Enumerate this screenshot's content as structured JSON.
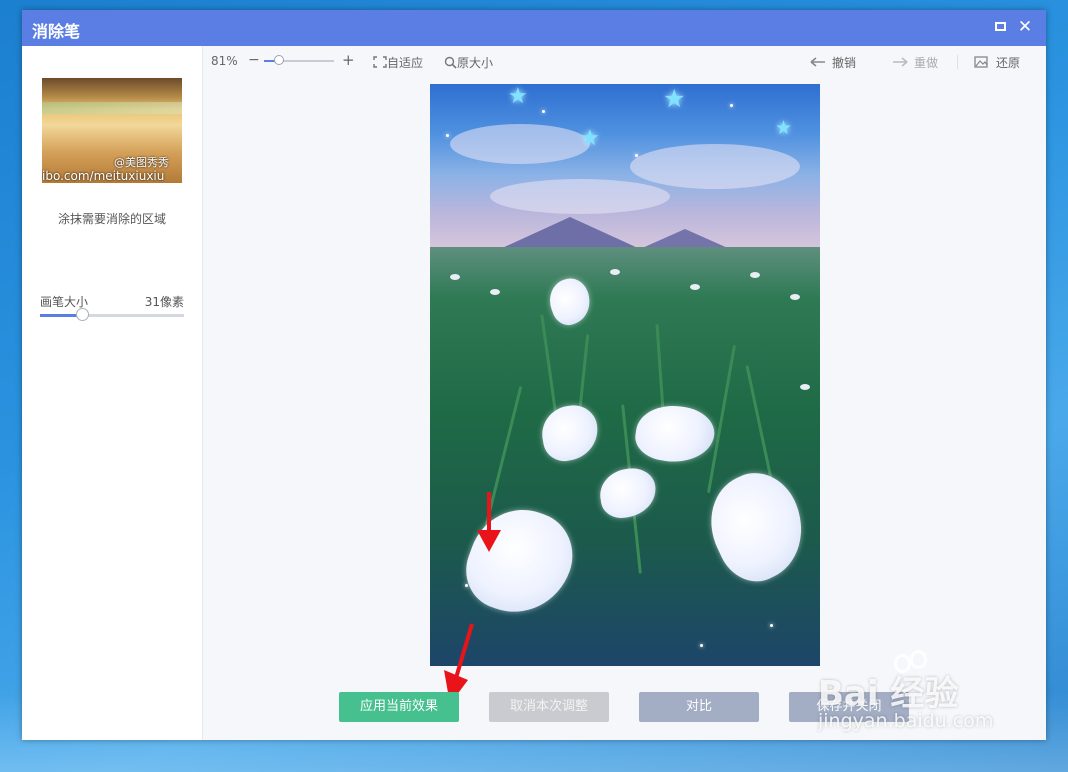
{
  "window": {
    "title": "消除笔"
  },
  "left_panel": {
    "thumbnail_watermark_1": "@美图秀秀",
    "thumbnail_watermark_2": "ibo.com/meituxiuxiu",
    "hint": "涂抹需要消除的区域",
    "brush": {
      "label": "画笔大小",
      "value": "31像素",
      "level": 0.29
    }
  },
  "toolbar": {
    "zoom_value": "81%",
    "zoom_minus": "−",
    "zoom_plus": "+",
    "zoom_level": 0.22,
    "fit_label": "自适应",
    "original_label": "原大小",
    "undo_label": "撤销",
    "redo_label": "重做",
    "restore_label": "还原"
  },
  "buttons": {
    "apply": "应用当前效果",
    "cancel": "取消本次调整",
    "compare": "对比",
    "save": "保存并关闭"
  },
  "watermark": {
    "main": "Bai 经验",
    "sub": "jingyan.baidu.com"
  },
  "colors": {
    "titlebar": "#5b7ee5",
    "apply_button": "#47c08f",
    "cancel_button": "#c9cbd1",
    "secondary_button": "#a3adc4",
    "annotation_arrow": "#e8141a"
  },
  "icons": {
    "maximize": "maximize-icon",
    "close": "close-icon",
    "fit": "fit-screen-icon",
    "original": "magnifier-icon",
    "undo": "arrow-left-icon",
    "redo": "arrow-right-icon",
    "restore": "image-restore-icon"
  }
}
